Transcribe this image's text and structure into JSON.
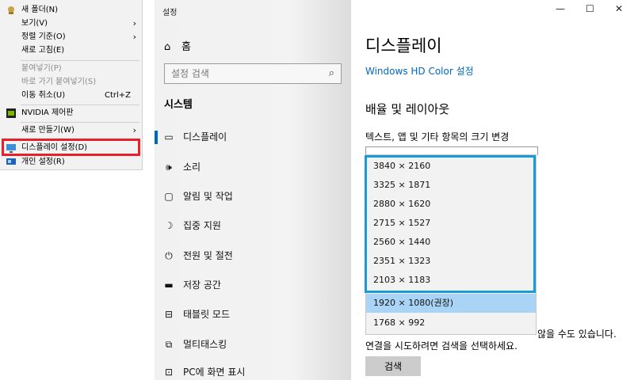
{
  "context_menu": {
    "items": [
      {
        "label": "새 폴더(N)",
        "icon": "new-folder-icon"
      },
      {
        "label": "보기(V)",
        "has_submenu": true
      },
      {
        "label": "정렬 기준(O)",
        "has_submenu": true
      },
      {
        "label": "새로 고침(E)"
      },
      {
        "label": "붙여넣기(P)",
        "disabled": true
      },
      {
        "label": "바로 가기 붙여넣기(S)",
        "disabled": true
      },
      {
        "label": "이동 취소(U)",
        "shortcut": "Ctrl+Z"
      },
      {
        "label": "NVIDIA 제어판",
        "icon": "nvidia-icon"
      },
      {
        "label": "새로 만들기(W)",
        "has_submenu": true
      },
      {
        "label": "디스플레이 설정(D)",
        "icon": "display-icon"
      },
      {
        "label": "개인 설정(R)",
        "icon": "personalize-icon"
      }
    ]
  },
  "settings": {
    "window_title": "설정",
    "home_label": "홈",
    "search_placeholder": "설정 검색",
    "section_header": "시스템",
    "nav": [
      {
        "label": "디스플레이",
        "icon": "monitor-icon",
        "active": true
      },
      {
        "label": "소리",
        "icon": "speaker-icon"
      },
      {
        "label": "알림 및 작업",
        "icon": "notification-icon"
      },
      {
        "label": "집중 지원",
        "icon": "moon-icon"
      },
      {
        "label": "전원 및 절전",
        "icon": "power-icon"
      },
      {
        "label": "저장 공간",
        "icon": "storage-icon"
      },
      {
        "label": "태블릿 모드",
        "icon": "tablet-icon"
      },
      {
        "label": "멀티태스킹",
        "icon": "multitasking-icon"
      },
      {
        "label": "PC에 화면 표시",
        "icon": "project-icon"
      }
    ],
    "page_title": "디스플레이",
    "hd_color_link": "Windows HD Color 설정",
    "scale_section_title": "배율 및 레이아웃",
    "scale_sub_label": "텍스트, 앱 및 기타 항목의 크기 변경",
    "resolutions": [
      "3840 × 2160",
      "3325 × 1871",
      "2880 × 1620",
      "2715 × 1527",
      "2560 × 1440",
      "2351 × 1323",
      "2103 × 1183",
      "1920 × 1080(권장)",
      "1768 × 992"
    ],
    "selected_resolution": "1920 × 1080(권장)",
    "behind_text": "않을 수도 있습니다.",
    "connect_text": "연결을 시도하려면 검색을 선택하세요.",
    "search_button": "검색",
    "window_controls": {
      "minimize": "—",
      "maximize": "☐",
      "close": "✕"
    }
  }
}
